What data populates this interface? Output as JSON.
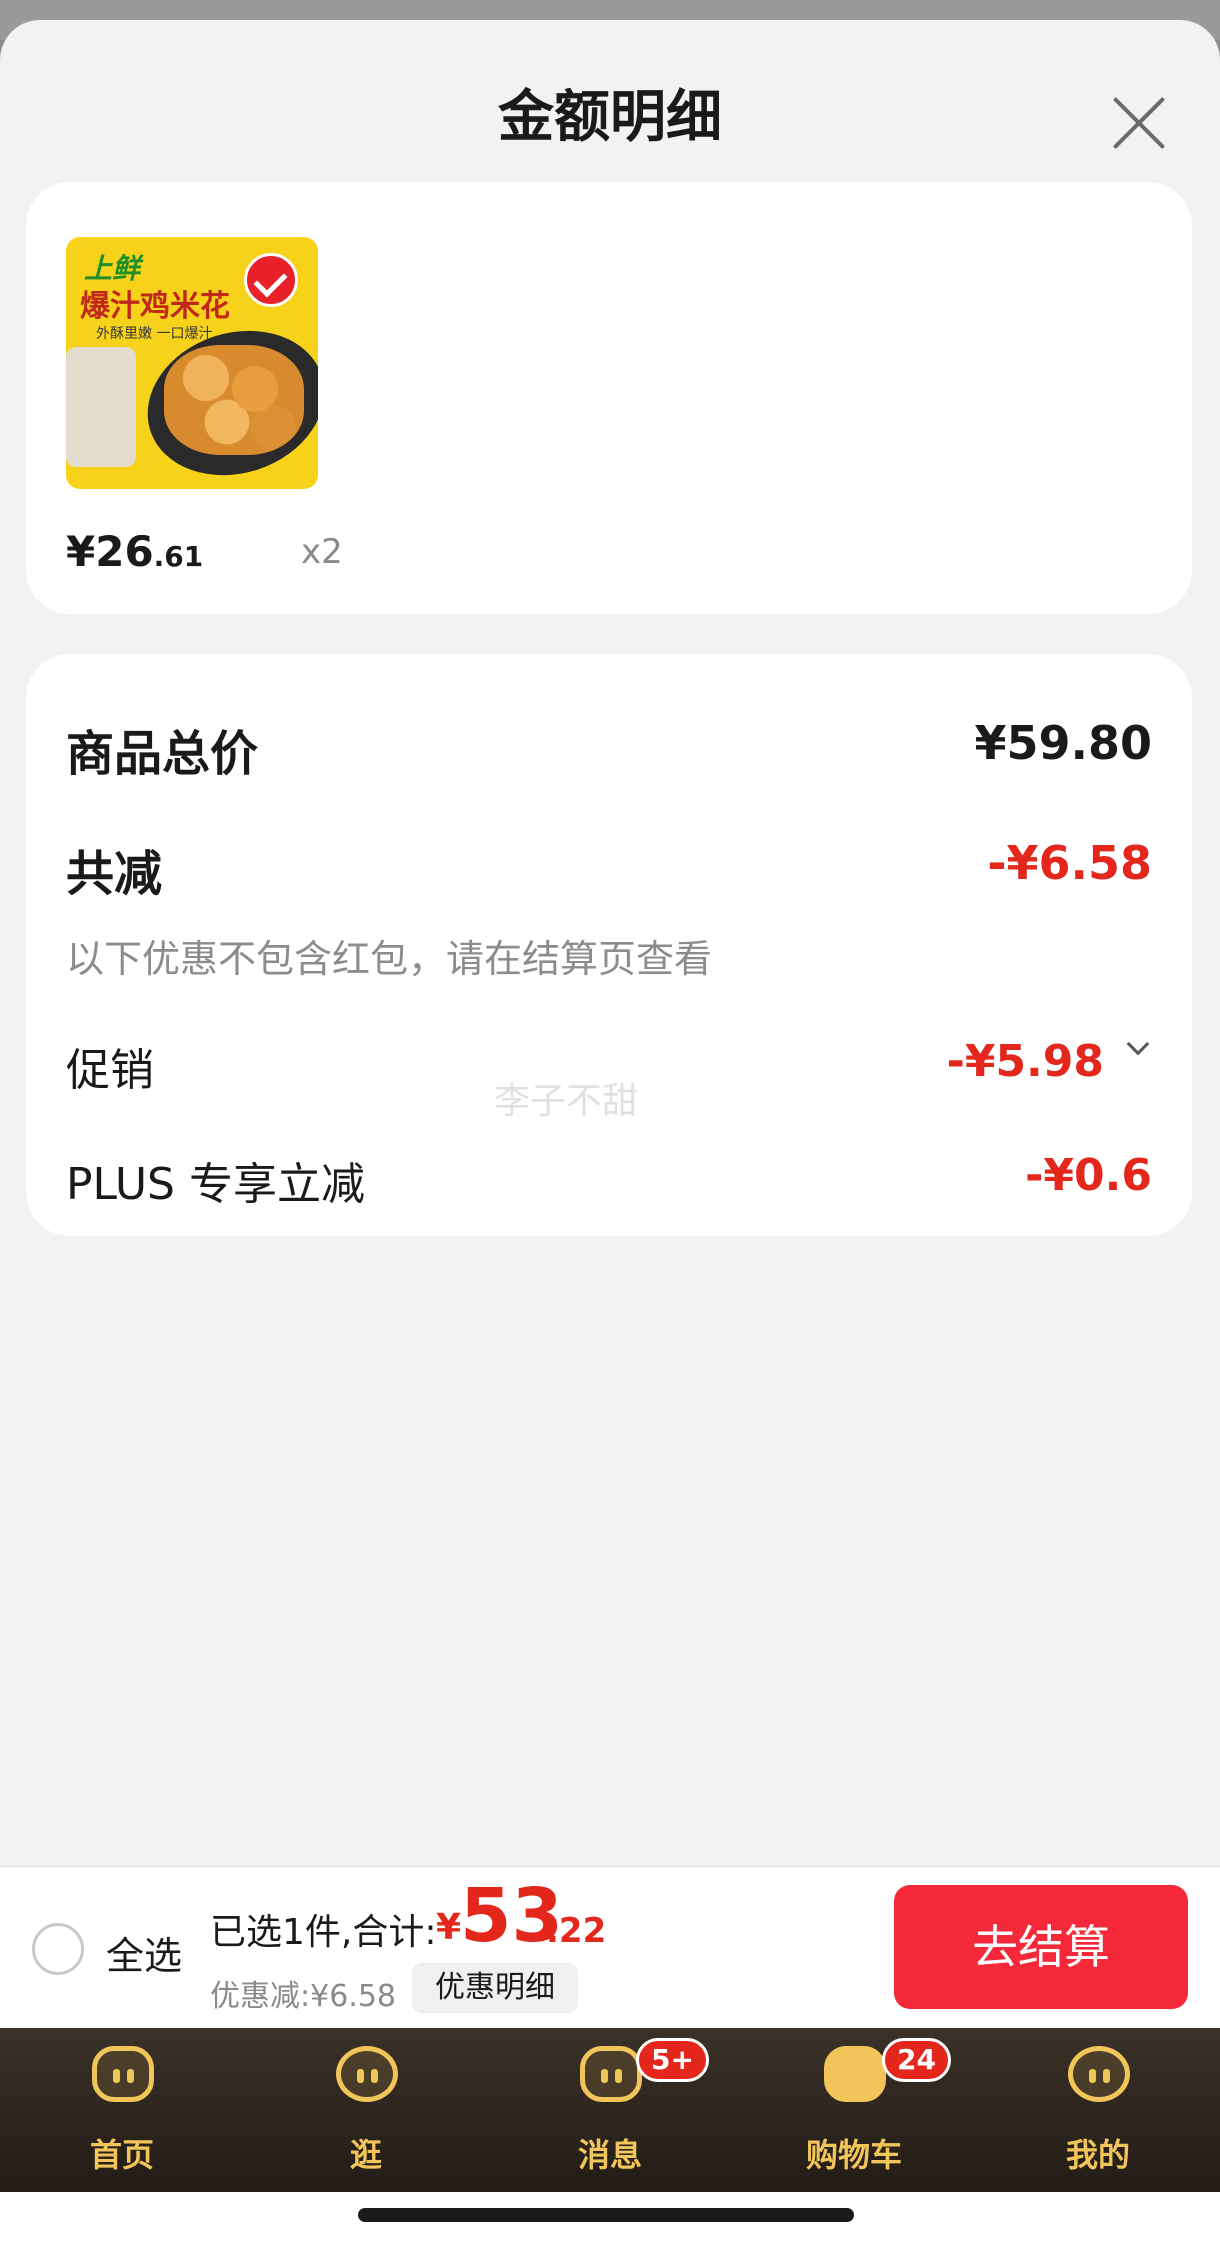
{
  "sheet": {
    "title": "金额明细"
  },
  "product": {
    "image_brand": "上鲜",
    "image_title": "爆汁鸡米花",
    "image_subtitle": "外酥里嫩 一口爆汁",
    "price_int": "¥26",
    "price_dec": ".61",
    "quantity": "x2",
    "selected": true
  },
  "summary": {
    "total_label": "商品总价",
    "total_value": "¥59.80",
    "reduction_label": "共减",
    "reduction_value": "-¥6.58",
    "note": "以下优惠不包含红包，请在结算页查看",
    "promo_label": "促销",
    "promo_value": "-¥5.98",
    "plus_label": "PLUS 专享立减",
    "plus_value": "-¥0.6"
  },
  "watermark": "李子不甜",
  "checkout": {
    "select_all": "全选",
    "selected_info": "已选1件,合计:",
    "total_currency": "¥",
    "total_int": "53",
    "total_dec": ".22",
    "discount": "优惠减:¥6.58",
    "detail_button": "优惠明细",
    "checkout_button": "去结算"
  },
  "tabbar": {
    "items": [
      {
        "label": "首页",
        "icon": "home-icon"
      },
      {
        "label": "逛",
        "icon": "browse-icon"
      },
      {
        "label": "消息",
        "icon": "message-icon",
        "badge": "5+"
      },
      {
        "label": "购物车",
        "icon": "cart-icon",
        "badge": "24"
      },
      {
        "label": "我的",
        "icon": "profile-icon"
      }
    ]
  },
  "colors": {
    "accent_red": "#e3271c",
    "checkout_red": "#f5293a",
    "tab_gold": "#f2c55a"
  }
}
